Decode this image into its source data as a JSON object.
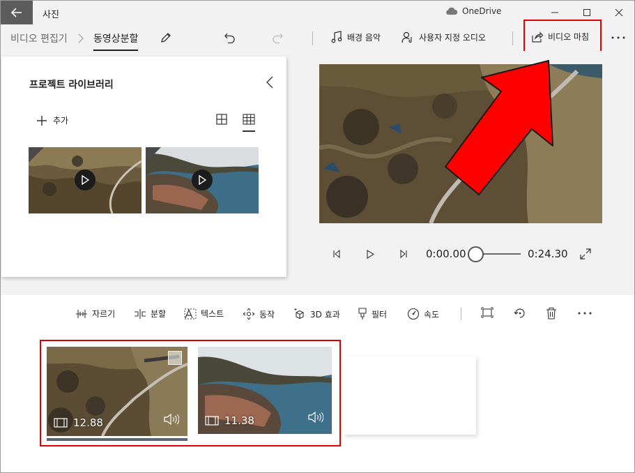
{
  "app": {
    "title": "사진",
    "onedrive_label": "OneDrive"
  },
  "toolbar": {
    "breadcrumb_root": "비디오 편집기",
    "breadcrumb_current": "동영상분할",
    "music_label": "배경 음악",
    "custom_audio_label": "사용자 지정 오디오",
    "finish_label": "비디오 마침"
  },
  "library": {
    "title": "프로젝트 라이브러리",
    "add_label": "추가"
  },
  "player": {
    "current_time": "0:00.00",
    "total_time": "0:24.30",
    "position_fraction": 0.0
  },
  "edit_tools": {
    "trim": "자르기",
    "split": "분할",
    "text": "텍스트",
    "motion": "동작",
    "effects_3d": "3D 효과",
    "filter": "필터",
    "speed": "속도"
  },
  "storyboard": {
    "clips": [
      {
        "duration": "12.88"
      },
      {
        "duration": "11.38"
      }
    ]
  },
  "colors": {
    "annotation_red": "#e00000",
    "background": "#f2f2f2",
    "back_button": "#5c5c5c"
  }
}
